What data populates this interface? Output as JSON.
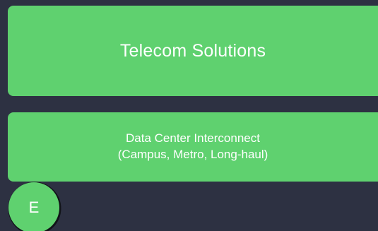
{
  "cards": {
    "top": {
      "title": "Telecom Solutions"
    },
    "middle": {
      "line1": "Data Center Interconnect",
      "line2": "(Campus, Metro, Long-haul)"
    }
  },
  "avatar": {
    "initial": "E"
  },
  "colors": {
    "background": "#2d3142",
    "card": "#5fd16f",
    "text": "#ffffff"
  }
}
